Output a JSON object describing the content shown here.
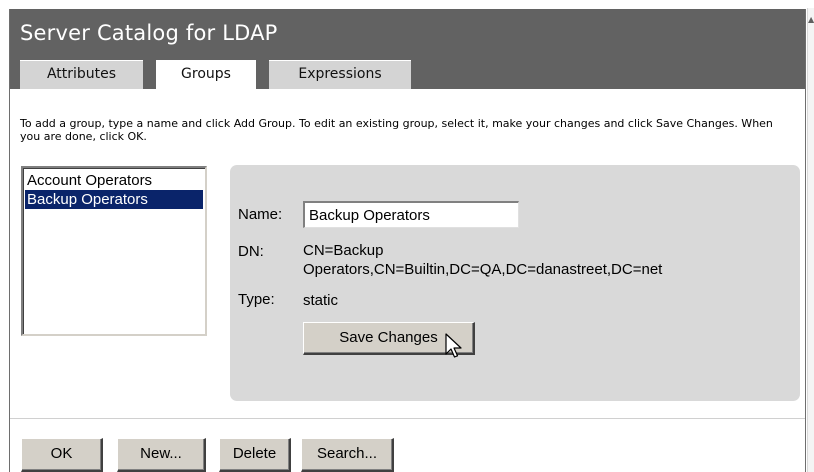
{
  "window": {
    "title": "Server Catalog for LDAP"
  },
  "tabs": [
    {
      "label": "Attributes",
      "active": false
    },
    {
      "label": "Groups",
      "active": true
    },
    {
      "label": "Expressions",
      "active": false
    }
  ],
  "instructions": "To add a group, type a name and click Add Group. To edit an existing group, select it, make your changes and click Save Changes. When you are done, click OK.",
  "groups_list": {
    "items": [
      {
        "label": "Account Operators",
        "selected": false
      },
      {
        "label": "Backup Operators",
        "selected": true
      }
    ]
  },
  "details": {
    "name_label": "Name:",
    "name_value": "Backup Operators",
    "dn_label": "DN:",
    "dn_value_line1": "CN=Backup",
    "dn_value_line2": "Operators,CN=Builtin,DC=QA,DC=danastreet,DC=net",
    "type_label": "Type:",
    "type_value": "static",
    "save_label": "Save Changes"
  },
  "footer": {
    "ok_label": "OK",
    "new_label": "New...",
    "delete_label": "Delete",
    "search_label": "Search..."
  },
  "colors": {
    "header_bg": "#626262",
    "tab_bg": "#d4d4d4",
    "selection_bg": "#0a246a",
    "panel_bg": "#d9d9d9",
    "button_face": "#d4d0c8"
  }
}
